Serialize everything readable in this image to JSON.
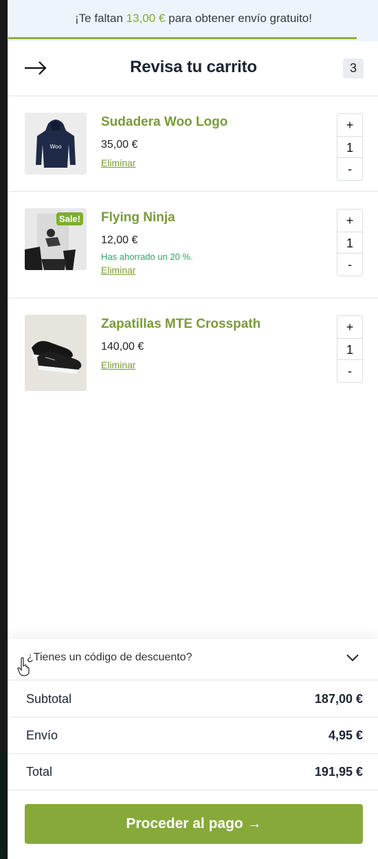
{
  "banner": {
    "prefix": "¡Te faltan ",
    "amount": "13,00 €",
    "suffix": " para obtener envío gratuito!",
    "progress": 0.94
  },
  "header": {
    "back_icon": "arrow-right-icon",
    "title": "Revisa tu carrito",
    "count": "3"
  },
  "items": [
    {
      "name": "Sudadera Woo Logo",
      "price": "35,00 €",
      "saved": "",
      "remove": "Eliminar",
      "qty": "1",
      "plus": "+",
      "minus": "-"
    },
    {
      "name": "Flying Ninja",
      "price": "12,00 €",
      "saved": "Has ahorrado un 20 %.",
      "remove": "Eliminar",
      "qty": "1",
      "plus": "+",
      "minus": "-",
      "badge": "Sale!"
    },
    {
      "name": "Zapatillas MTE Crosspath",
      "price": "140,00 €",
      "saved": "",
      "remove": "Eliminar",
      "qty": "1",
      "plus": "+",
      "minus": "-"
    }
  ],
  "coupon": {
    "label": "¿Tienes un código de descuento?",
    "icon": "chevron-down-icon"
  },
  "totals": {
    "subtotal_label": "Subtotal",
    "subtotal_value": "187,00 €",
    "shipping_label": "Envío",
    "shipping_value": "4,95 €",
    "total_label": "Total",
    "total_value": "191,95 €"
  },
  "checkout": {
    "label": "Proceder al pago →"
  },
  "colors": {
    "accent": "#86a93a",
    "link": "#7a9b3a",
    "saved": "#2fa36a",
    "banner_bg": "#eef4fb"
  }
}
